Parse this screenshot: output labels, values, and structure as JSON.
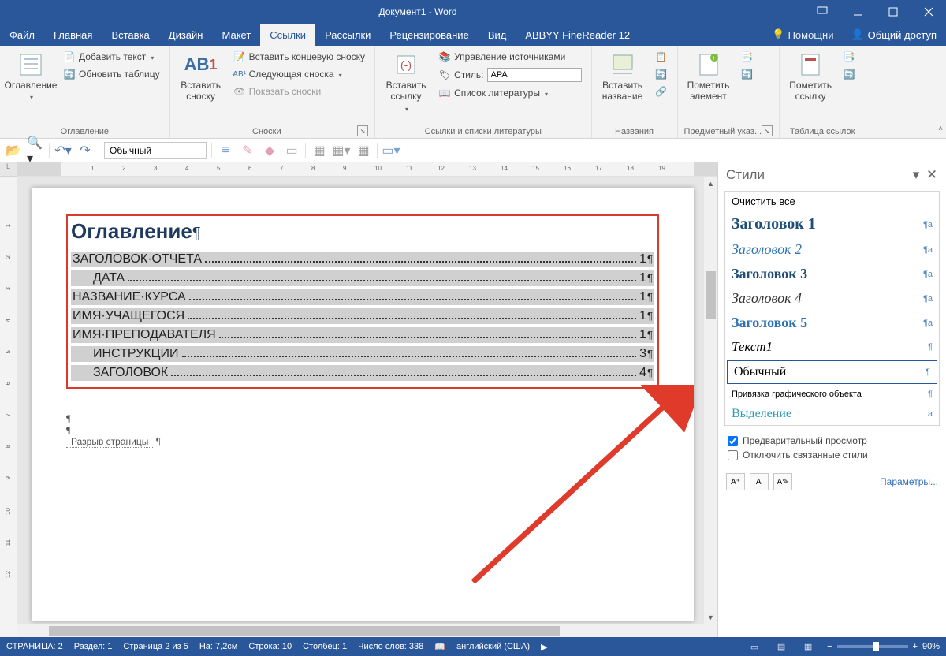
{
  "window": {
    "title": "Документ1 - Word"
  },
  "tabs": {
    "file": "Файл",
    "home": "Главная",
    "insert": "Вставка",
    "design": "Дизайн",
    "layout": "Макет",
    "references": "Ссылки",
    "mailings": "Рассылки",
    "review": "Рецензирование",
    "view": "Вид",
    "abbyy": "ABBYY FineReader 12",
    "tell": "Помощни",
    "share": "Общий доступ"
  },
  "ribbon": {
    "toc": {
      "button": "Оглавление",
      "add_text": "Добавить текст",
      "update": "Обновить таблицу",
      "group": "Оглавление"
    },
    "footnotes": {
      "insert": "Вставить сноску",
      "endnote": "Вставить концевую сноску",
      "next": "Следующая сноска",
      "show": "Показать сноски",
      "group": "Сноски",
      "ab": "AB"
    },
    "citations": {
      "insert": "Вставить ссылку",
      "manage": "Управление источниками",
      "style_label": "Стиль:",
      "style_value": "APA",
      "biblio": "Список литературы",
      "group": "Ссылки и списки литературы"
    },
    "captions": {
      "insert": "Вставить название",
      "group": "Названия"
    },
    "index": {
      "mark": "Пометить элемент",
      "group": "Предметный указ..."
    },
    "toa": {
      "mark": "Пометить ссылку",
      "group": "Таблица ссылок"
    }
  },
  "qat": {
    "style_combo": "Обычный"
  },
  "doc": {
    "toc_title": "Оглавление",
    "entries": [
      {
        "text": "ЗАГОЛОВОК·ОТЧЕТА",
        "page": "1",
        "indent": false
      },
      {
        "text": "ДАТА",
        "page": "1",
        "indent": true
      },
      {
        "text": "НАЗВАНИЕ·КУРСА",
        "page": "1",
        "indent": false
      },
      {
        "text": "ИМЯ·УЧАЩЕГОСЯ",
        "page": "1",
        "indent": false
      },
      {
        "text": "ИМЯ·ПРЕПОДАВАТЕЛЯ",
        "page": "1",
        "indent": false
      },
      {
        "text": "ИНСТРУКЦИИ",
        "page": "3",
        "indent": true
      },
      {
        "text": "ЗАГОЛОВОК",
        "page": "4",
        "indent": true
      }
    ],
    "page_break": "Разрыв страницы"
  },
  "styles_pane": {
    "title": "Стили",
    "clear": "Очистить все",
    "items": {
      "h1": "Заголовок 1",
      "h2": "Заголовок 2",
      "h3": "Заголовок 3",
      "h4": "Заголовок 4",
      "h5": "Заголовок 5",
      "t1": "Текст1",
      "normal": "Обычный",
      "anchor": "Привязка графического объекта",
      "sel": "Выделение"
    },
    "preview": "Предварительный просмотр",
    "linked": "Отключить связанные стили",
    "options": "Параметры..."
  },
  "status": {
    "page": "СТРАНИЦА: 2",
    "section": "Раздел: 1",
    "page_of": "Страница 2 из 5",
    "at": "На: 7,2см",
    "line": "Строка: 10",
    "col": "Столбец: 1",
    "words": "Число слов: 338",
    "lang": "английский (США)",
    "zoom": "90%"
  }
}
